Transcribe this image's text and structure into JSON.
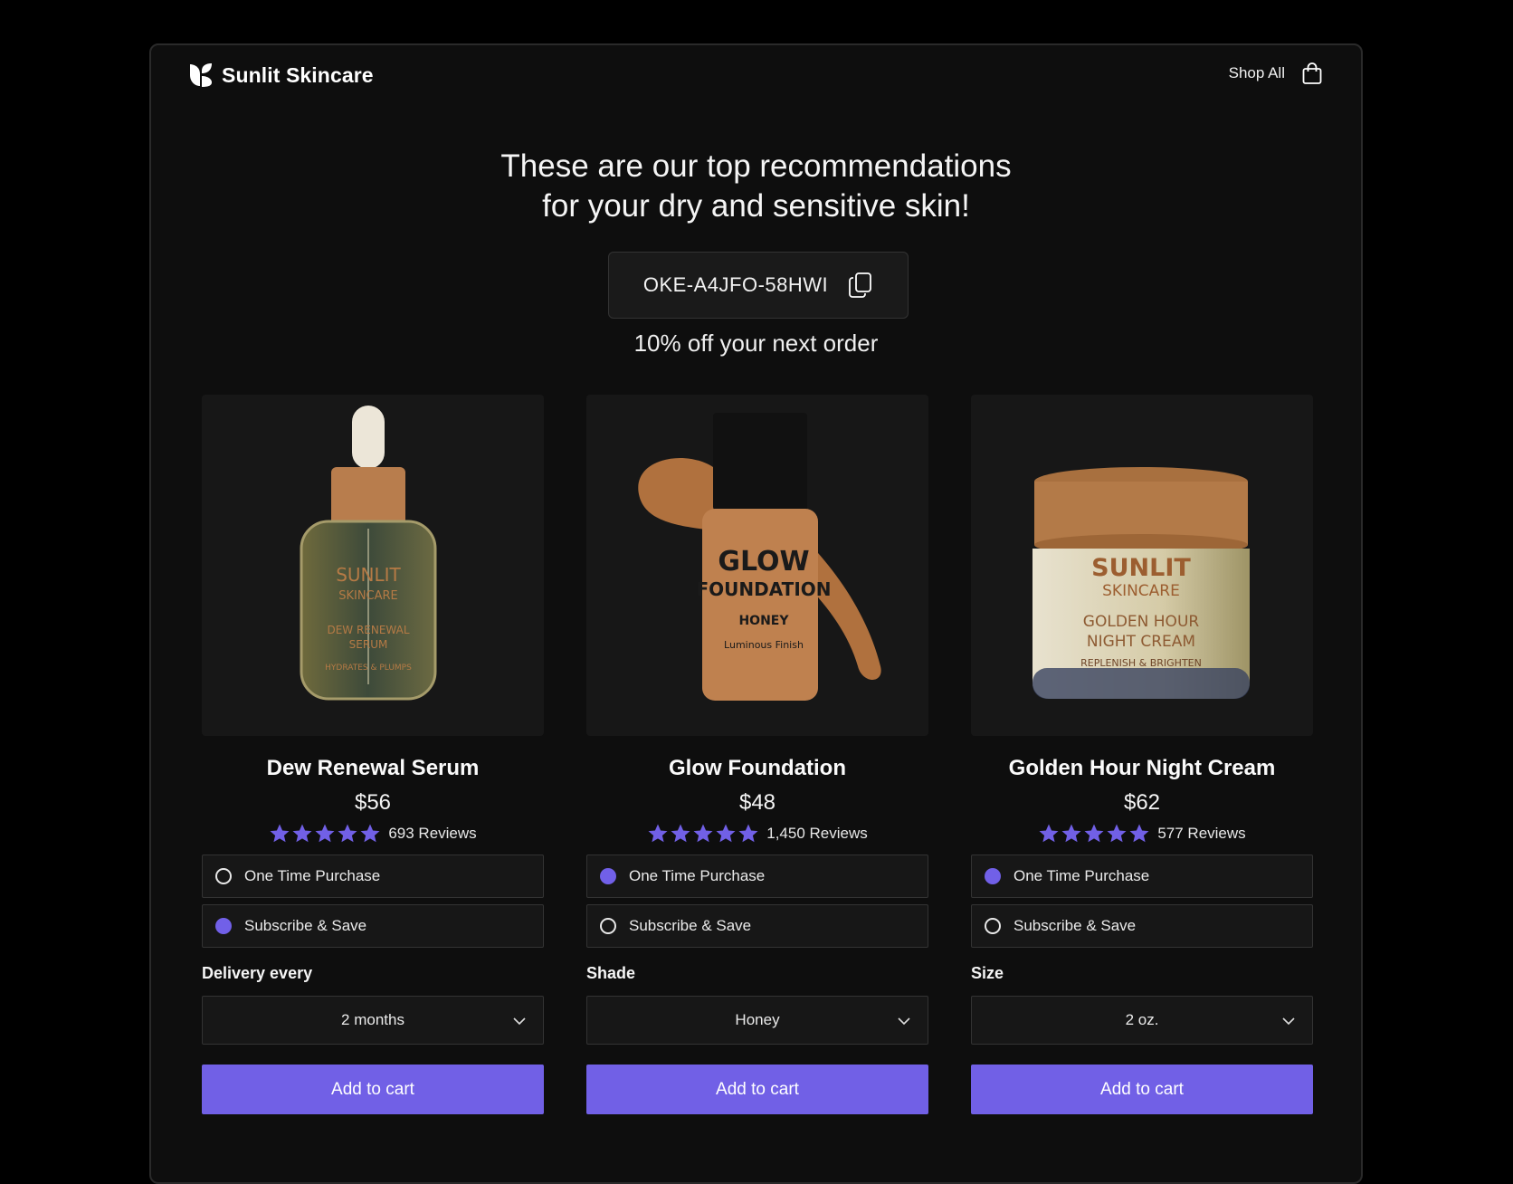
{
  "brand": {
    "name": "Sunlit Skincare",
    "logo_icon": "leaf-logo-icon"
  },
  "nav": {
    "shop_all": "Shop All",
    "cart_icon": "shopping-bag-icon"
  },
  "hero": {
    "line1": "These are our top recommendations",
    "line2": "for your dry and sensitive skin!"
  },
  "coupon": {
    "code": "OKE-A4JFO-58HWI",
    "note": "10% off your next order",
    "copy_icon": "copy-icon"
  },
  "colors": {
    "accent": "#7160e6",
    "background": "#0e0e0e",
    "card": "#171717"
  },
  "products": [
    {
      "name": "Dew Renewal Serum",
      "price": "$56",
      "rating": 5,
      "reviews": "693 Reviews",
      "label_lines": [
        "SUNLIT",
        "SKINCARE",
        "DEW RENEWAL",
        "SERUM",
        "HYDRATES & PLUMPS"
      ],
      "options": [
        {
          "label": "One Time Purchase",
          "selected": false
        },
        {
          "label": "Subscribe & Save",
          "selected": true
        }
      ],
      "field_label": "Delivery every",
      "select_value": "2 months",
      "button": "Add to cart"
    },
    {
      "name": "Glow Foundation",
      "price": "$48",
      "rating": 5,
      "reviews": "1,450 Reviews",
      "label_lines": [
        "GLOW",
        "FOUNDATION",
        "HONEY",
        "Luminous Finish"
      ],
      "options": [
        {
          "label": "One Time Purchase",
          "selected": true
        },
        {
          "label": "Subscribe & Save",
          "selected": false
        }
      ],
      "field_label": "Shade",
      "select_value": "Honey",
      "button": "Add to cart"
    },
    {
      "name": "Golden Hour Night Cream",
      "price": "$62",
      "rating": 5,
      "reviews": "577 Reviews",
      "label_lines": [
        "SUNLIT",
        "SKINCARE",
        "GOLDEN HOUR",
        "NIGHT CREAM",
        "REPLENISH & BRIGHTEN"
      ],
      "options": [
        {
          "label": "One Time Purchase",
          "selected": true
        },
        {
          "label": "Subscribe & Save",
          "selected": false
        }
      ],
      "field_label": "Size",
      "select_value": "2 oz.",
      "button": "Add to cart"
    }
  ]
}
